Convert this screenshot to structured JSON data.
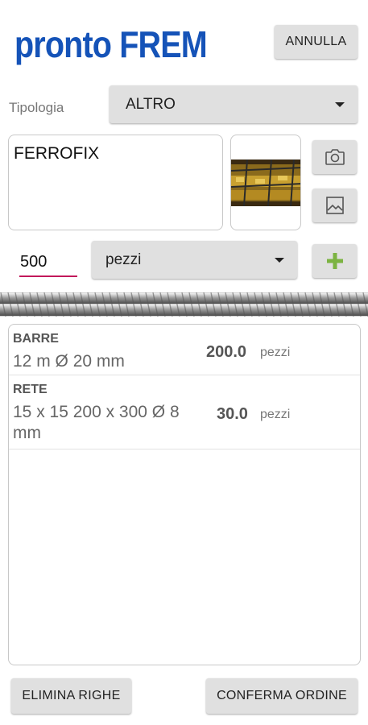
{
  "header": {
    "app_title": "pronto FREM",
    "cancel_label": "ANNULLA"
  },
  "type": {
    "label": "Tipologia",
    "selected": "ALTRO"
  },
  "description": {
    "value": "FERROFIX"
  },
  "quantity": {
    "value": "500",
    "unit_selected": "pezzi"
  },
  "icons": {
    "camera": "camera-icon",
    "gallery": "image-gallery-icon",
    "add": "plus-icon",
    "add_color": "#7cb342",
    "accent_underline": "#c2185b",
    "brand": "#1553b8"
  },
  "order_lines": [
    {
      "category": "BARRE",
      "description": "12 m Ø 20 mm",
      "quantity": "200.0",
      "unit": "pezzi"
    },
    {
      "category": "RETE",
      "description": "15 x 15 200 x 300 Ø 8 mm",
      "quantity": "30.0",
      "unit": "pezzi"
    }
  ],
  "footer": {
    "delete_label": "ELIMINA RIGHE",
    "confirm_label": "CONFERMA ORDINE"
  }
}
